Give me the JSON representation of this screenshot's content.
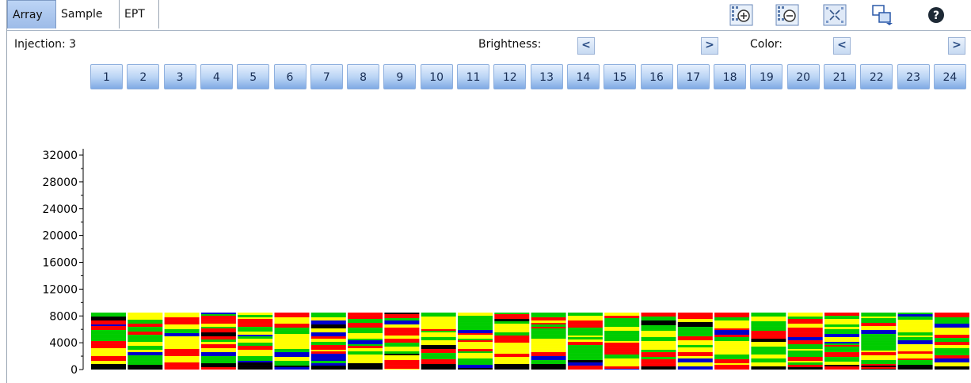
{
  "tabs": [
    {
      "label": "Array",
      "active": true
    },
    {
      "label": "Sample",
      "active": false
    },
    {
      "label": "EPT",
      "active": false
    }
  ],
  "toolbar": [
    {
      "icon": "zoom-in-icon"
    },
    {
      "icon": "zoom-out-icon"
    },
    {
      "icon": "fit-to-window-icon"
    },
    {
      "icon": "export-chart-icon"
    },
    {
      "icon": "help-icon"
    }
  ],
  "info": {
    "injection_label": "Injection: 3",
    "brightness_label": "Brightness:",
    "color_label": "Color:",
    "left_arrow": "<",
    "right_arrow": ">"
  },
  "columns": [
    "1",
    "2",
    "3",
    "4",
    "5",
    "6",
    "7",
    "8",
    "9",
    "10",
    "11",
    "12",
    "13",
    "14",
    "15",
    "16",
    "17",
    "18",
    "19",
    "20",
    "21",
    "22",
    "23",
    "24"
  ],
  "chart_data": {
    "type": "heatmap",
    "title": "",
    "xlabel": "",
    "ylabel": "",
    "ylim": [
      0,
      32000
    ],
    "y_ticks": [
      "32000",
      "28000",
      "24000",
      "20000",
      "16000",
      "12000",
      "8000",
      "4000",
      "0"
    ],
    "categories": [
      "1",
      "2",
      "3",
      "4",
      "5",
      "6",
      "7",
      "8",
      "9",
      "10",
      "11",
      "12",
      "13",
      "14",
      "15",
      "16",
      "17",
      "18",
      "19",
      "20",
      "21",
      "22",
      "23",
      "24"
    ],
    "band_top_value": 8500,
    "band_colors": [
      "#00cc00",
      "#ffff00",
      "#ff0000",
      "#0000cc",
      "#000000"
    ],
    "note_colors_order": "green, yellow, red, blue, black"
  },
  "colors": {
    "accent": "#9dbbe8",
    "button": "#b7d2f4"
  }
}
